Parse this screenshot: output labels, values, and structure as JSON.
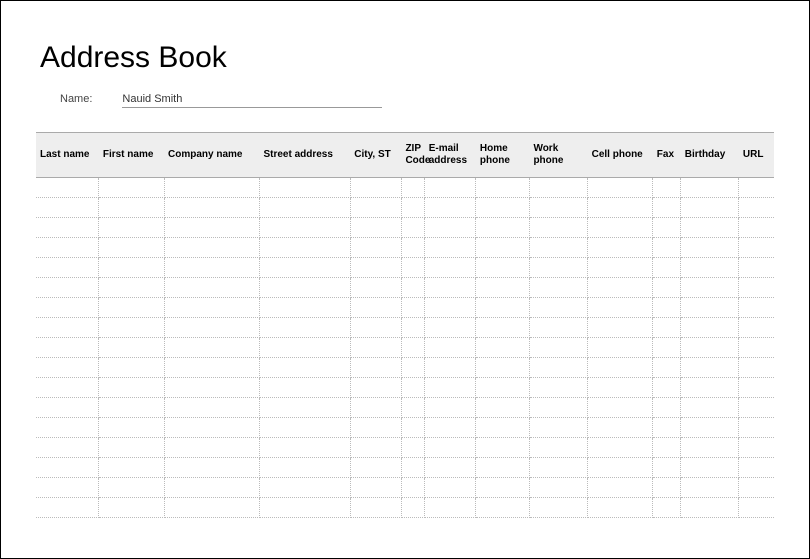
{
  "title": "Address Book",
  "name_label": "Name:",
  "name_value": "Nauid Smith",
  "columns": {
    "last_name": "Last name",
    "first_name": "First name",
    "company_name": "Company name",
    "street_address": "Street address",
    "city_st": "City, ST",
    "zip_code": "ZIP Code",
    "email": "E-mail address",
    "home_phone": "Home phone",
    "work_phone": "Work phone",
    "cell_phone": "Cell phone",
    "fax": "Fax",
    "birthday": "Birthday",
    "url": "URL"
  },
  "row_count": 17
}
